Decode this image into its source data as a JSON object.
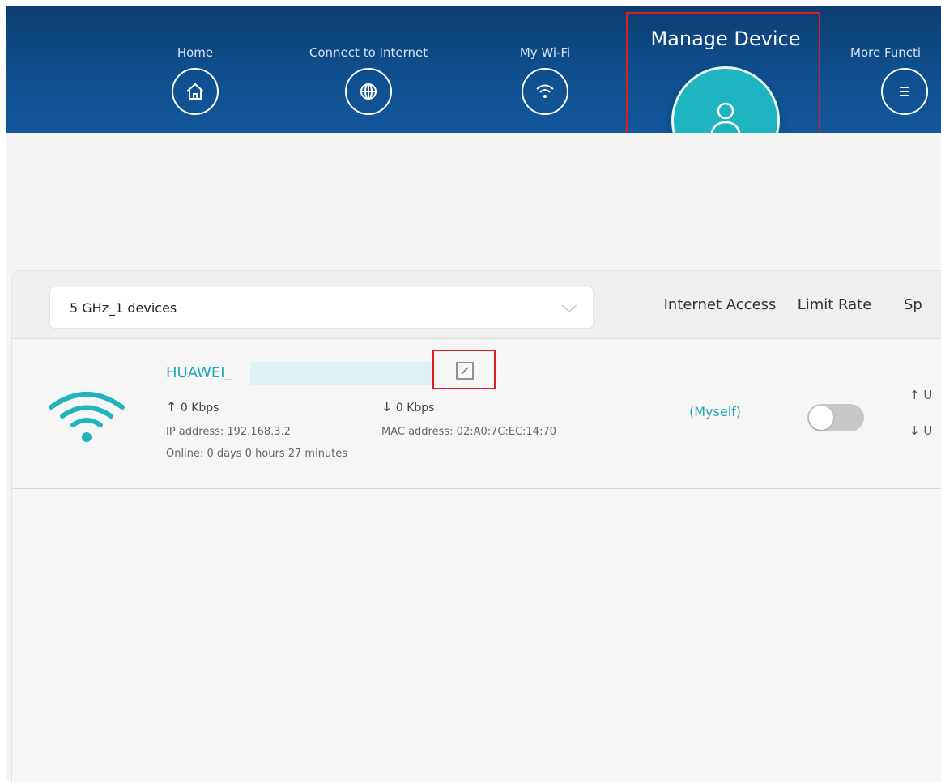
{
  "nav": {
    "items": [
      {
        "label": "Home",
        "icon": "home-icon"
      },
      {
        "label": "Connect to Internet",
        "icon": "globe-icon"
      },
      {
        "label": "My Wi-Fi",
        "icon": "wifi-icon"
      },
      {
        "label": "Manage Device",
        "icon": "user-icon",
        "active": true
      },
      {
        "label": "More Functi",
        "icon": "menu-icon"
      }
    ]
  },
  "table": {
    "band_select": {
      "value": "5 GHz_1 devices"
    },
    "headers": {
      "internet_access": "Internet Access",
      "limit_rate": "Limit Rate",
      "speed": "Sp"
    },
    "rows": [
      {
        "name": "HUAWEI_",
        "upload": "0 Kbps",
        "download": "0 Kbps",
        "ip": "IP address: 192.168.3.2",
        "mac": "MAC address: 02:A0:7C:EC:14:70",
        "online": "Online: 0 days 0 hours 27 minutes",
        "internet_access": "(Myself)",
        "limit_rate_enabled": false,
        "speed_up": "U",
        "speed_down": "U"
      }
    ]
  },
  "colors": {
    "nav_bg": "#0f4f8f",
    "accent": "#1fb5c0",
    "highlight": "#e01b1b"
  }
}
